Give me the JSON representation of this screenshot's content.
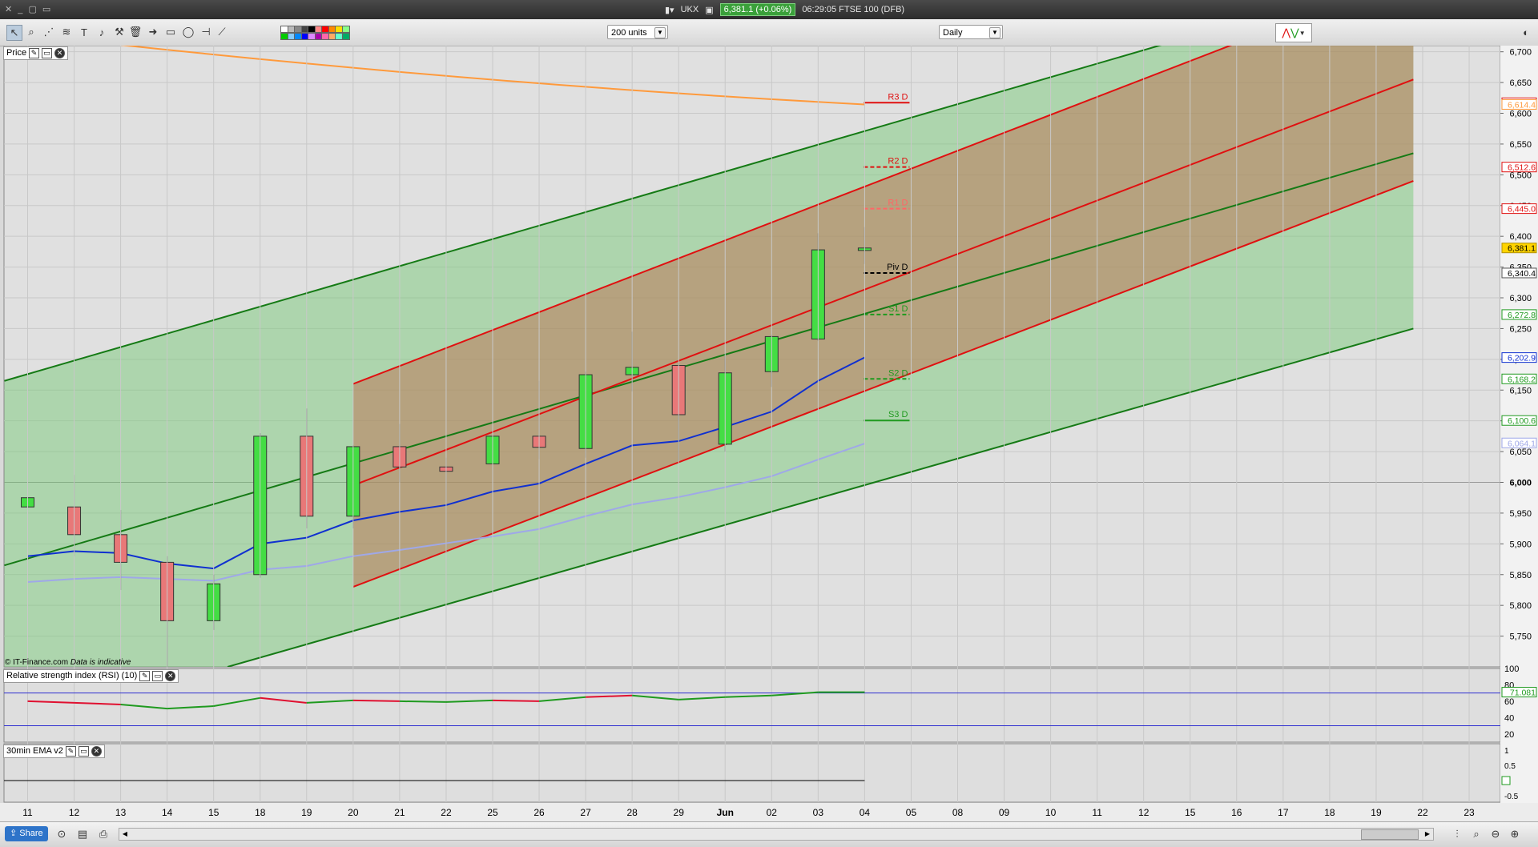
{
  "window": {
    "symbol": "UKX",
    "price_badge": "6,381.1 (+0.06%)",
    "status": "06:29:05 FTSE 100 (DFB)"
  },
  "toolbar": {
    "units": "200 units",
    "period": "Daily"
  },
  "panels": {
    "price": "Price",
    "rsi": "Relative strength index (RSI) (10)",
    "ema": "30min EMA v2"
  },
  "footer": {
    "copyright": "© IT-Finance.com",
    "disclaimer": "Data is indicative",
    "share": "Share"
  },
  "colors": {
    "up": "#44dd44",
    "down": "#e87878",
    "ema_fast": "#1030d0",
    "ema_slow": "#9fa8e8",
    "channel_green": "#157a15",
    "channel_red": "#e01010",
    "orange_ma": "#ff9a3c"
  },
  "chart_data": {
    "type": "candlestick",
    "x_tick_labels": [
      "11",
      "12",
      "13",
      "14",
      "15",
      "18",
      "19",
      "20",
      "21",
      "22",
      "25",
      "26",
      "27",
      "28",
      "29",
      "Jun",
      "02",
      "03",
      "04",
      "05",
      "08",
      "09",
      "10",
      "11",
      "12",
      "15",
      "16",
      "17",
      "18",
      "19",
      "22",
      "23"
    ],
    "ylim": [
      5700,
      6710
    ],
    "y_ticks": [
      5750,
      5800,
      5850,
      5900,
      5950,
      6000,
      6050,
      6100,
      6150,
      6200,
      6250,
      6300,
      6350,
      6400,
      6450,
      6500,
      6550,
      6600,
      6650,
      6700
    ],
    "y_tick_labels": [
      "5,750",
      "5,800",
      "5,850",
      "5,900",
      "5,950",
      "6,000",
      "6,050",
      "6,100",
      "6,150",
      "6,200",
      "6,250",
      "6,300",
      "6,350",
      "6,400",
      "6,450",
      "6,500",
      "6,550",
      "6,600",
      "6,650",
      "6,700"
    ],
    "candles": [
      {
        "o": 5960,
        "h": 6010,
        "l": 5900,
        "c": 5975
      },
      {
        "o": 5960,
        "h": 6012,
        "l": 5880,
        "c": 5915
      },
      {
        "o": 5915,
        "h": 5955,
        "l": 5825,
        "c": 5870
      },
      {
        "o": 5870,
        "h": 5880,
        "l": 5700,
        "c": 5775
      },
      {
        "o": 5775,
        "h": 5850,
        "l": 5760,
        "c": 5835
      },
      {
        "o": 5850,
        "h": 6080,
        "l": 5845,
        "c": 6075
      },
      {
        "o": 6075,
        "h": 6120,
        "l": 5925,
        "c": 5945
      },
      {
        "o": 5945,
        "h": 6060,
        "l": 5925,
        "c": 6058
      },
      {
        "o": 6058,
        "h": 6095,
        "l": 6000,
        "c": 6025
      },
      {
        "o": 6025,
        "h": 6040,
        "l": 5885,
        "c": 6018
      },
      {
        "o": 6030,
        "h": 6098,
        "l": 6008,
        "c": 6075
      },
      {
        "o": 6075,
        "h": 6165,
        "l": 6038,
        "c": 6057
      },
      {
        "o": 6055,
        "h": 6180,
        "l": 6040,
        "c": 6175
      },
      {
        "o": 6175,
        "h": 6245,
        "l": 6148,
        "c": 6187
      },
      {
        "o": 6190,
        "h": 6195,
        "l": 6035,
        "c": 6110
      },
      {
        "o": 6062,
        "h": 6205,
        "l": 6050,
        "c": 6178
      },
      {
        "o": 6180,
        "h": 6240,
        "l": 6155,
        "c": 6237
      },
      {
        "o": 6233,
        "h": 6405,
        "l": 6230,
        "c": 6378
      },
      {
        "o": 6377,
        "h": 6415,
        "l": 6355,
        "c": 6381
      }
    ],
    "ema_fast": [
      5880,
      5888,
      5885,
      5868,
      5860,
      5900,
      5910,
      5938,
      5952,
      5963,
      5985,
      5998,
      6030,
      6060,
      6067,
      6090,
      6115,
      6165,
      6203
    ],
    "ema_slow": [
      5838,
      5843,
      5846,
      5843,
      5840,
      5858,
      5864,
      5880,
      5890,
      5901,
      5912,
      5924,
      5945,
      5964,
      5976,
      5992,
      6010,
      6037,
      6063
    ],
    "orange_ma": {
      "x0": 0,
      "y0": 6720,
      "x1": 18,
      "y1": 6614.4
    },
    "channel_green_outer": [
      {
        "x0": -0.5,
        "y0": 6165,
        "x1": 29.8,
        "y1": 6830
      },
      {
        "x0": 4.3,
        "y0": 5700,
        "x1": 29.8,
        "y1": 6250
      }
    ],
    "channel_green_mid": {
      "x0": -0.5,
      "y0": 5865,
      "x1": 29.8,
      "y1": 6535
    },
    "channel_red": [
      {
        "x0": 7,
        "y0": 6160,
        "x1": 29.8,
        "y1": 6825
      },
      {
        "x0": 7,
        "y0": 5830,
        "x1": 29.8,
        "y1": 6490
      },
      {
        "x0": 7,
        "y0": 5995,
        "x1": 29.8,
        "y1": 6655
      }
    ],
    "pivots": [
      {
        "label": "R3 D",
        "value": 6617.2,
        "color": "#e01010",
        "dash": false
      },
      {
        "label": "R2 D",
        "value": 6512.6,
        "color": "#e01010",
        "dash": true
      },
      {
        "label": "R1 D",
        "value": 6445.0,
        "color": "#ff6666",
        "dash": true
      },
      {
        "label": "Piv D",
        "value": 6340.4,
        "color": "#000000",
        "dash": true
      },
      {
        "label": "S1 D",
        "value": 6272.8,
        "color": "#1f9a1f",
        "dash": true
      },
      {
        "label": "S2 D",
        "value": 6168.2,
        "color": "#1f9a1f",
        "dash": true
      },
      {
        "label": "S3 D",
        "value": 6100.6,
        "color": "#1f9a1f",
        "dash": false
      }
    ],
    "price_tags": [
      {
        "value": 6617.2,
        "text": "6,617.2",
        "bg": "#ffffff",
        "fg": "#e01010",
        "border": "#e01010"
      },
      {
        "value": 6614.4,
        "text": "6,614.4",
        "bg": "#ffffff",
        "fg": "#ff9a3c",
        "border": "#ff9a3c"
      },
      {
        "value": 6512.6,
        "text": "6,512.6",
        "bg": "#ffffff",
        "fg": "#e01010",
        "border": "#e01010"
      },
      {
        "value": 6445.0,
        "text": "6,445.0",
        "bg": "#ffffff",
        "fg": "#e01010",
        "border": "#e01010"
      },
      {
        "value": 6381.1,
        "text": "6,381.1",
        "bg": "#ffd400",
        "fg": "#000000",
        "border": "#b09000"
      },
      {
        "value": 6340.4,
        "text": "6,340.4",
        "bg": "#ffffff",
        "fg": "#000000",
        "border": "#555555"
      },
      {
        "value": 6272.8,
        "text": "6,272.8",
        "bg": "#ffffff",
        "fg": "#1f9a1f",
        "border": "#1f9a1f"
      },
      {
        "value": 6202.9,
        "text": "6,202.9",
        "bg": "#ffffff",
        "fg": "#1030d0",
        "border": "#1030d0"
      },
      {
        "value": 6168.2,
        "text": "6,168.2",
        "bg": "#ffffff",
        "fg": "#1f9a1f",
        "border": "#1f9a1f"
      },
      {
        "value": 6100.6,
        "text": "6,100.6",
        "bg": "#ffffff",
        "fg": "#1f9a1f",
        "border": "#1f9a1f"
      },
      {
        "value": 6064.1,
        "text": "6,064.1",
        "bg": "#ffffff",
        "fg": "#9fa8e8",
        "border": "#9fa8e8"
      }
    ],
    "rsi": {
      "values": [
        60,
        58,
        56,
        51,
        54,
        64,
        58,
        61,
        60,
        59,
        61,
        60,
        65,
        67,
        62,
        65,
        67,
        71,
        71
      ],
      "colors": [
        "#e01030",
        "#e01030",
        "#e01030",
        "#1f9a1f",
        "#1f9a1f",
        "#1f9a1f",
        "#e01030",
        "#1f9a1f",
        "#e01030",
        "#1f9a1f",
        "#1f9a1f",
        "#e01030",
        "#1f9a1f",
        "#e01030",
        "#1f9a1f",
        "#1f9a1f",
        "#1f9a1f",
        "#1f9a1f",
        "#1f9a1f"
      ],
      "ylim": [
        10,
        100
      ],
      "levels": [
        70,
        30
      ],
      "y_tick_labels": [
        "100",
        "80",
        "60",
        "40",
        "20"
      ],
      "last": "71.081"
    },
    "ema_panel": {
      "y_tick_labels": [
        "1",
        "0.5",
        "0",
        "-0.5"
      ],
      "value": 0
    }
  }
}
